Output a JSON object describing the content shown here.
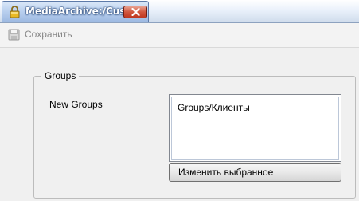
{
  "window": {
    "tab_title": "MediaArchive:/Cust",
    "tab_icon": "lock-icon",
    "close_icon": "close-icon"
  },
  "toolbar": {
    "save_label": "Сохранить",
    "save_icon": "save-icon",
    "save_enabled": false
  },
  "form": {
    "group_title": "Groups",
    "field_label": "New Groups",
    "list_items": [
      "Groups/Клиенты"
    ],
    "edit_button_label": "Изменить выбранное"
  },
  "colors": {
    "tab_active": "#b8cfee",
    "close_button": "#d1563d",
    "window_background": "#f0f0f0"
  }
}
